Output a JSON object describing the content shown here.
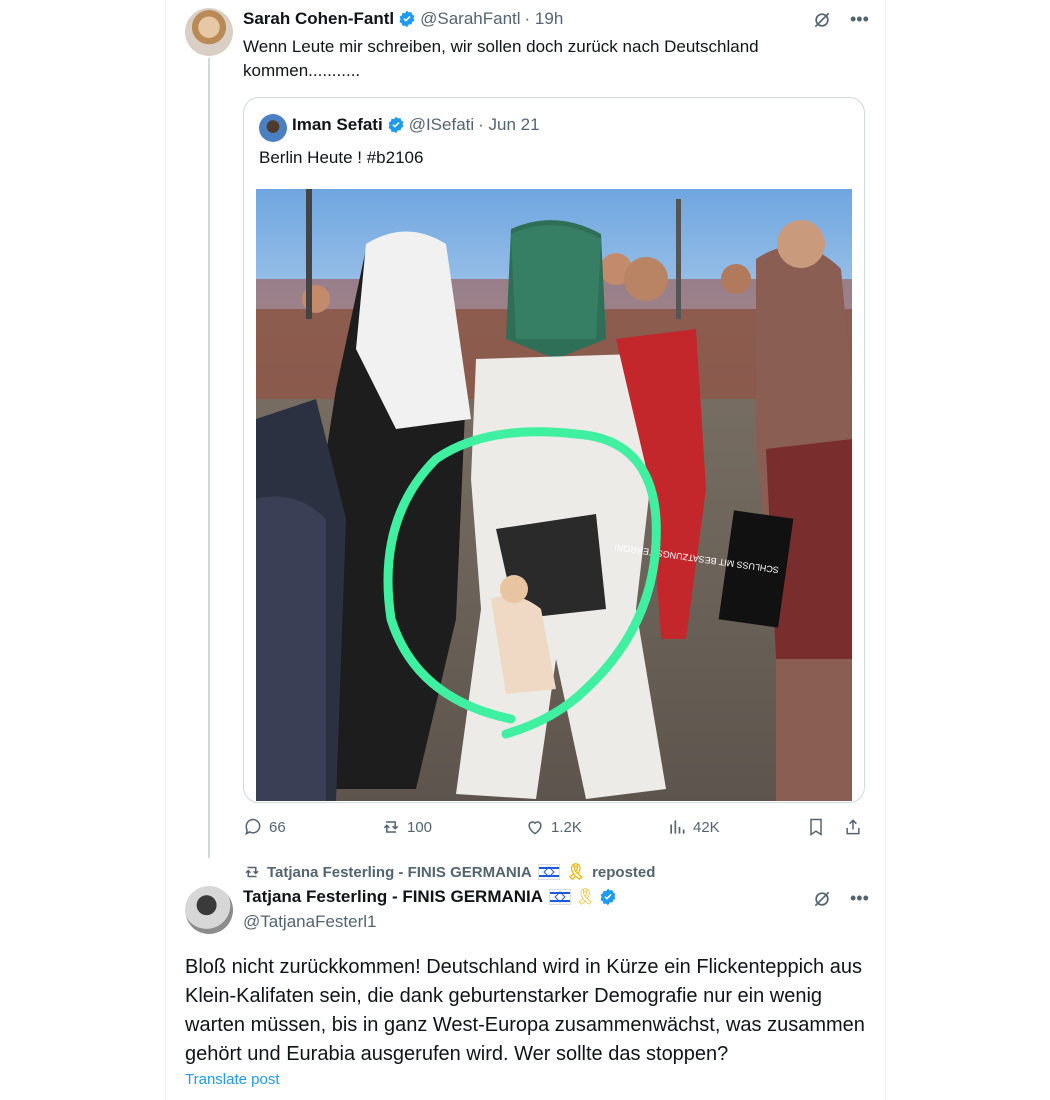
{
  "tweet1": {
    "name": "Sarah Cohen-Fantl",
    "handle": "@SarahFantl",
    "time": "· 19h",
    "text": "Wenn Leute mir schreiben, wir sollen doch zurück nach Deutschland kommen..........."
  },
  "quote": {
    "name": "Iman Sefati",
    "handle": "@ISefati",
    "time": "· Jun 21",
    "text": "Berlin Heute ! #b2106",
    "image_sign_text": "SCHLUSS MIT BESATZUNGS TERROR!"
  },
  "actions": {
    "replies": "66",
    "reposts": "100",
    "likes": "1.2K",
    "views": "42K"
  },
  "repost_line": {
    "name": "Tatjana Festerling - FINIS GERMANIA",
    "label": "reposted"
  },
  "tweet2": {
    "name": "Tatjana Festerling - FINIS GERMANIA",
    "handle": "@TatjanaFesterl1",
    "text": "Bloß nicht zurückkommen! Deutschland wird in Kürze ein Flickenteppich aus Klein-Kalifaten sein, die dank geburtenstarker Demografie nur ein wenig warten müssen, bis in ganz West-Europa zusammenwächst, was zusammen gehört und Eurabia ausgerufen wird. Wer sollte das stoppen?",
    "translate": "Translate post"
  },
  "colors": {
    "accent": "#1d9bf0",
    "muted": "#536471",
    "highlight_circle": "#3ef0a0"
  }
}
